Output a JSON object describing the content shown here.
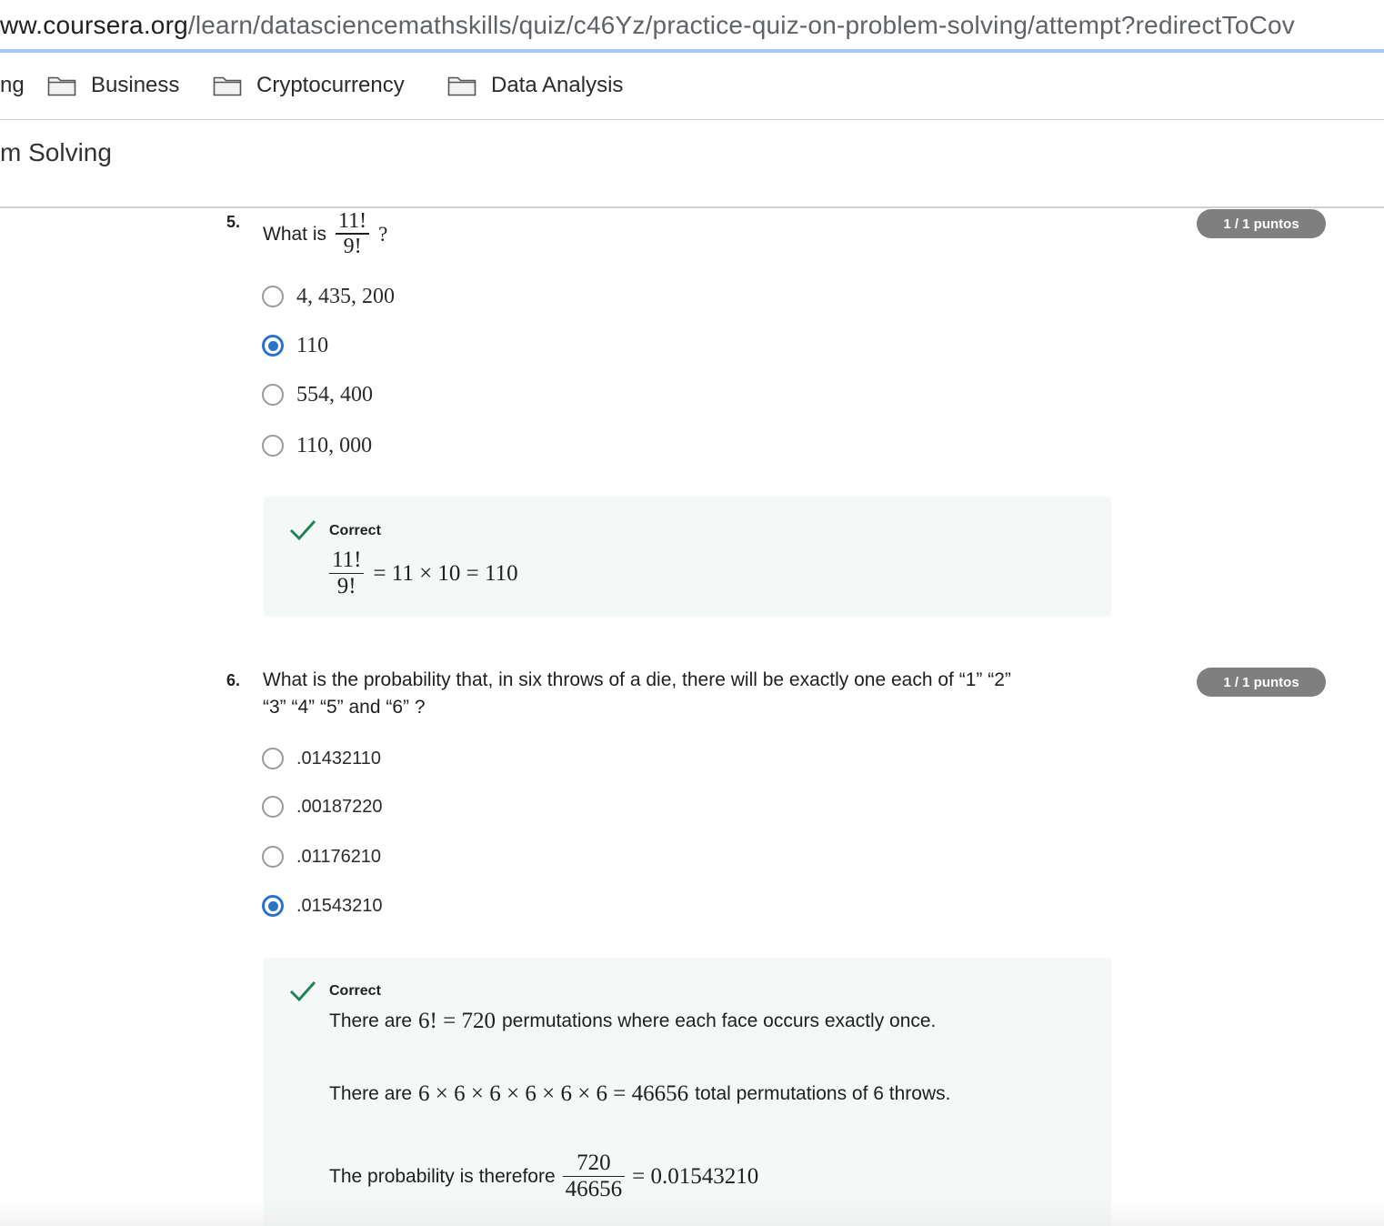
{
  "browser": {
    "url_domain": "ww.coursera.org",
    "url_path": "/learn/datasciencemathskills/quiz/c46Yz/practice-quiz-on-problem-solving/attempt?redirectToCov"
  },
  "bookmarks": [
    {
      "label": "ng"
    },
    {
      "label": "Business",
      "icon": "folder-icon"
    },
    {
      "label": "Cryptocurrency",
      "icon": "folder-icon"
    },
    {
      "label": "Data Analysis",
      "icon": "folder-icon"
    }
  ],
  "page": {
    "title": "m Solving"
  },
  "questions": [
    {
      "number": "5.",
      "prompt_prefix": "What is",
      "prompt_fraction": {
        "num": "11!",
        "den": "9!"
      },
      "prompt_suffix": "?",
      "points": "1 / 1 puntos",
      "options": [
        {
          "label": "4, 435, 200",
          "selected": false
        },
        {
          "label": "110",
          "selected": true
        },
        {
          "label": "554, 400",
          "selected": false
        },
        {
          "label": "110, 000",
          "selected": false
        }
      ],
      "feedback": {
        "status": "Correct",
        "fraction": {
          "num": "11!",
          "den": "9!"
        },
        "expression": "= 11 × 10 = 110"
      }
    },
    {
      "number": "6.",
      "prompt_line1": "What is the probability that, in six throws of a die, there will be exactly one each of “1”  “2”",
      "prompt_line2": "“3”  “4”  “5”  and “6” ?",
      "points": "1 / 1 puntos",
      "options": [
        {
          "label": ".01432110",
          "selected": false
        },
        {
          "label": ".00187220",
          "selected": false
        },
        {
          "label": ".01176210",
          "selected": false
        },
        {
          "label": ".01543210",
          "selected": true
        }
      ],
      "feedback": {
        "status": "Correct",
        "line1_a": "There are",
        "line1_math": "6! = 720",
        "line1_b": "permutations where each face occurs exactly once.",
        "line2_a": "There are",
        "line2_math": "6 × 6 × 6 × 6 × 6 × 6 = 46656",
        "line2_b": "total permutations of 6 throws.",
        "line3_a": "The probability is therefore",
        "line3_fraction": {
          "num": "720",
          "den": "46656"
        },
        "line3_math": "= 0.01543210"
      }
    }
  ],
  "colors": {
    "accent": "#2a73cc",
    "correct": "#1f8354",
    "badge": "#7f7f7f",
    "feedback_bg": "#f4f8f6"
  }
}
